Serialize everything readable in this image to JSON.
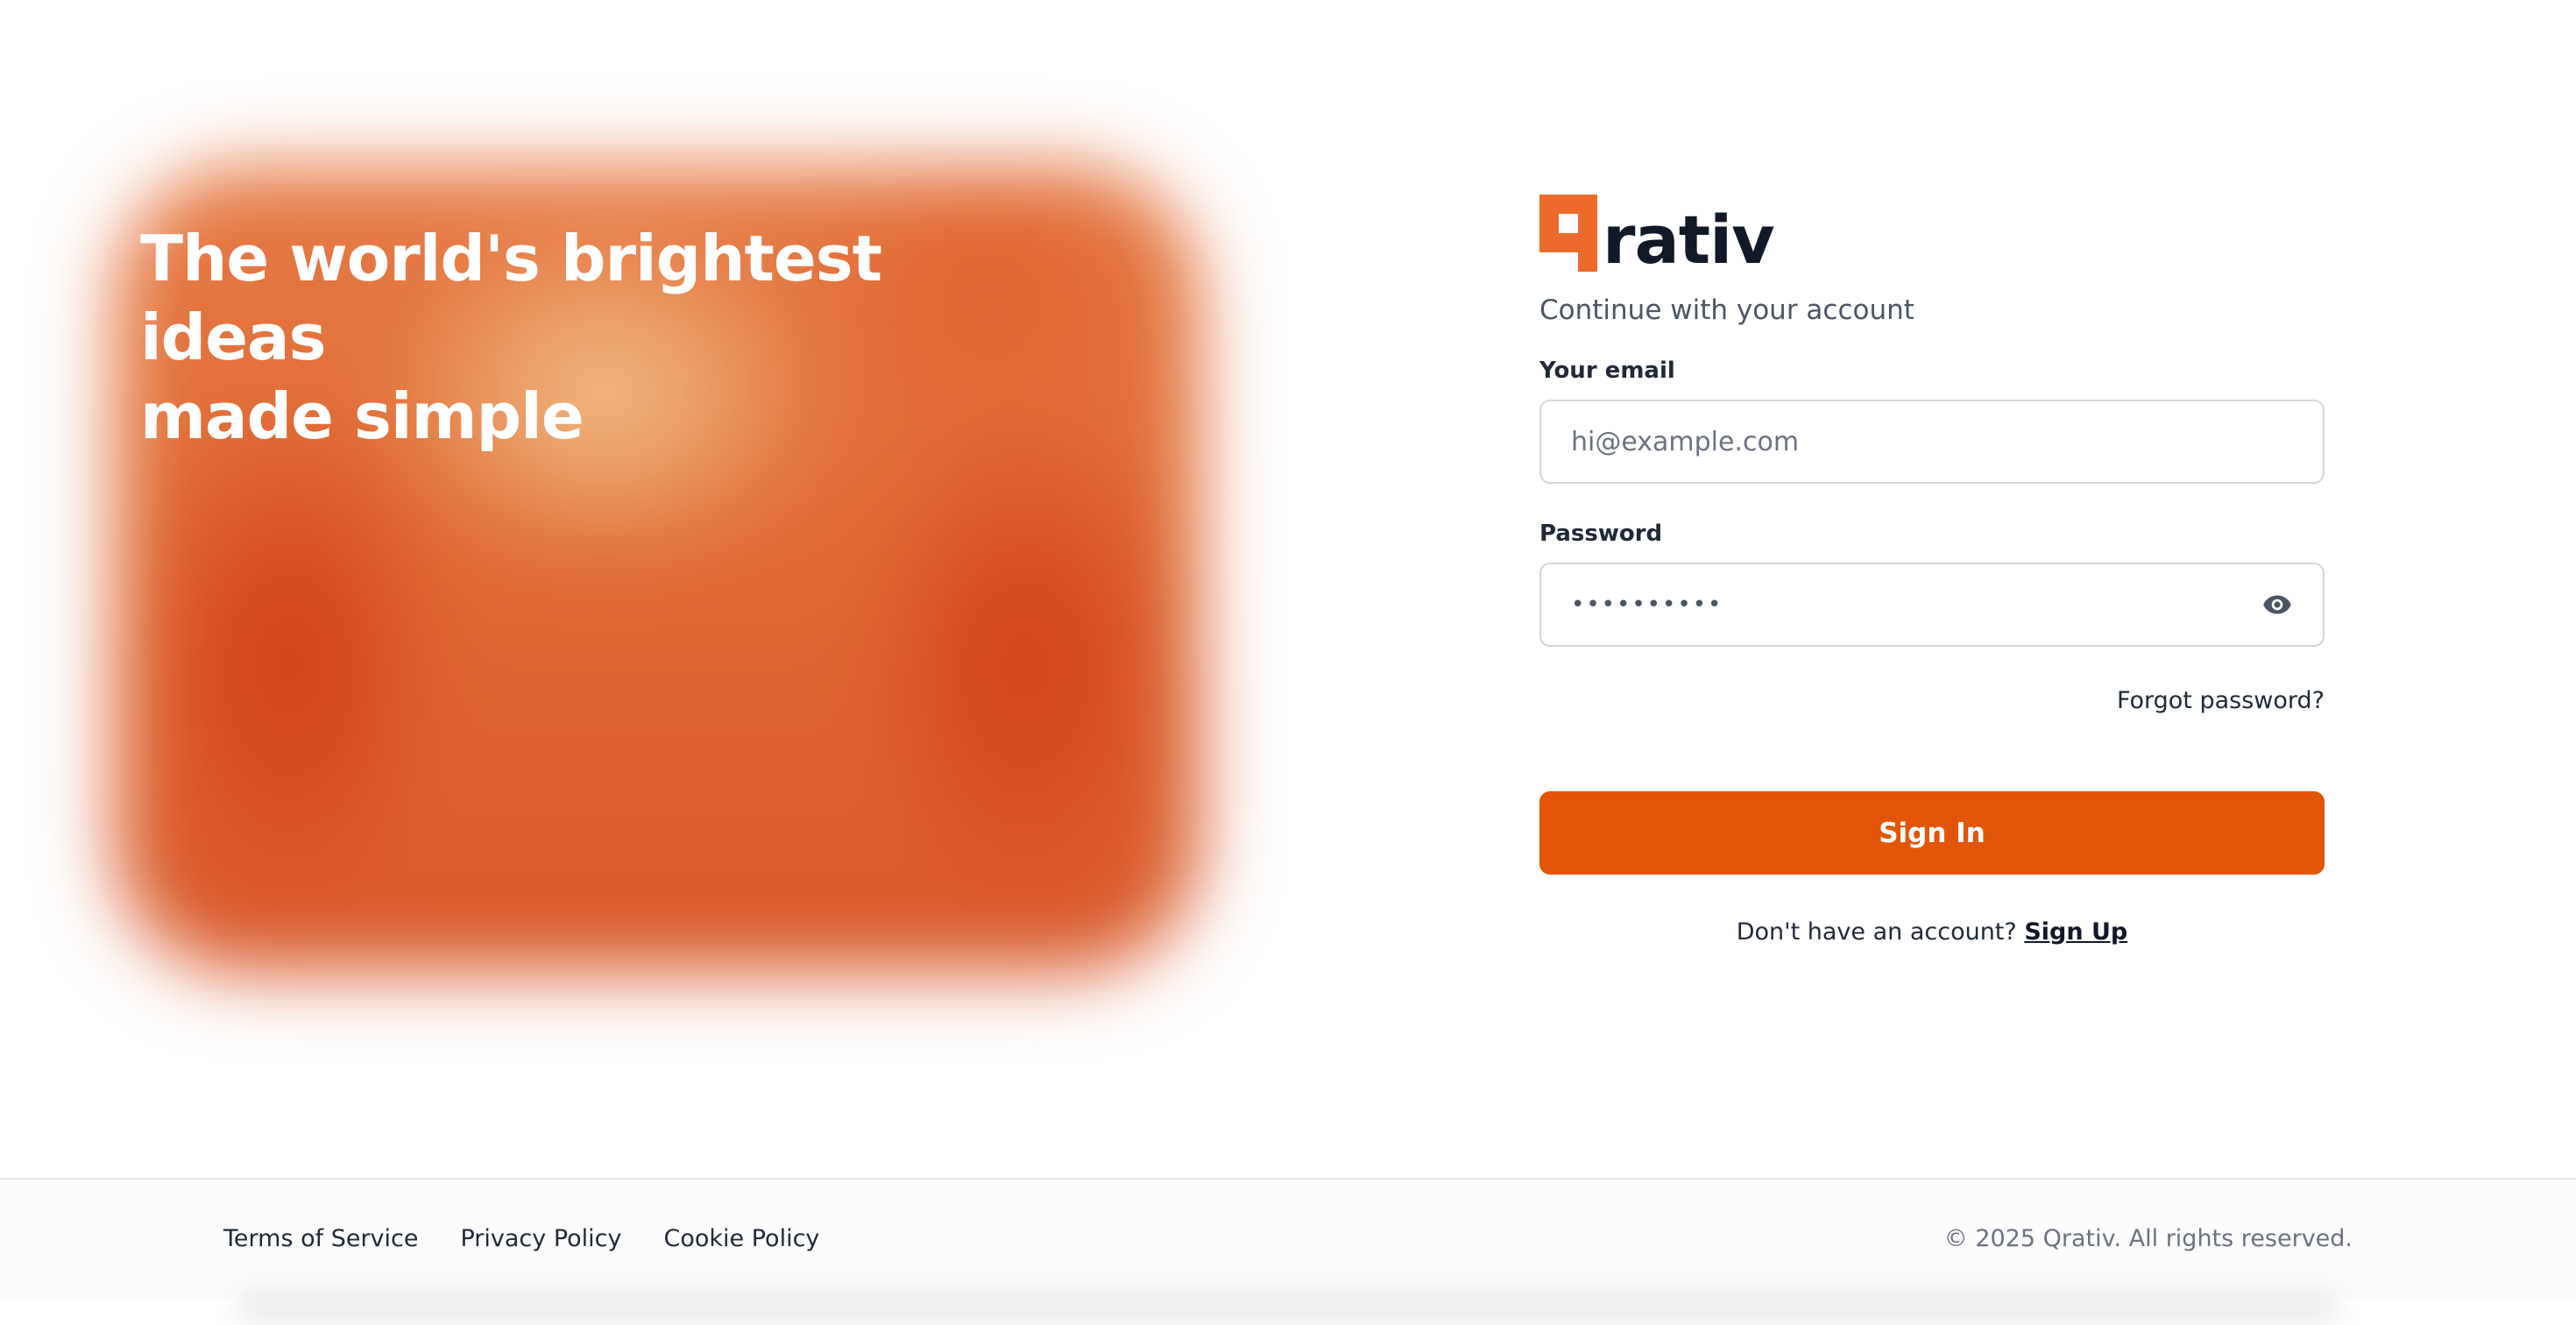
{
  "hero": {
    "headline_line1": "The world's brightest ideas",
    "headline_line2": "made simple"
  },
  "brand": {
    "name": "rativ",
    "accent_color": "#ec6b2c",
    "button_color": "#e25508",
    "logo_icon": "qrativ-pixel-q-mark"
  },
  "form": {
    "subtitle": "Continue with your account",
    "email": {
      "label": "Your email",
      "placeholder": "hi@example.com",
      "value": ""
    },
    "password": {
      "label": "Password",
      "value": "••••••••••",
      "toggle_icon": "eye-icon"
    },
    "forgot_label": "Forgot password?",
    "submit_label": "Sign In",
    "signup_prompt": "Don't have an account?",
    "signup_link": "Sign Up"
  },
  "footer": {
    "links": [
      "Terms of Service",
      "Privacy Policy",
      "Cookie Policy"
    ],
    "copyright": "© 2025 Qrativ. All rights reserved."
  }
}
